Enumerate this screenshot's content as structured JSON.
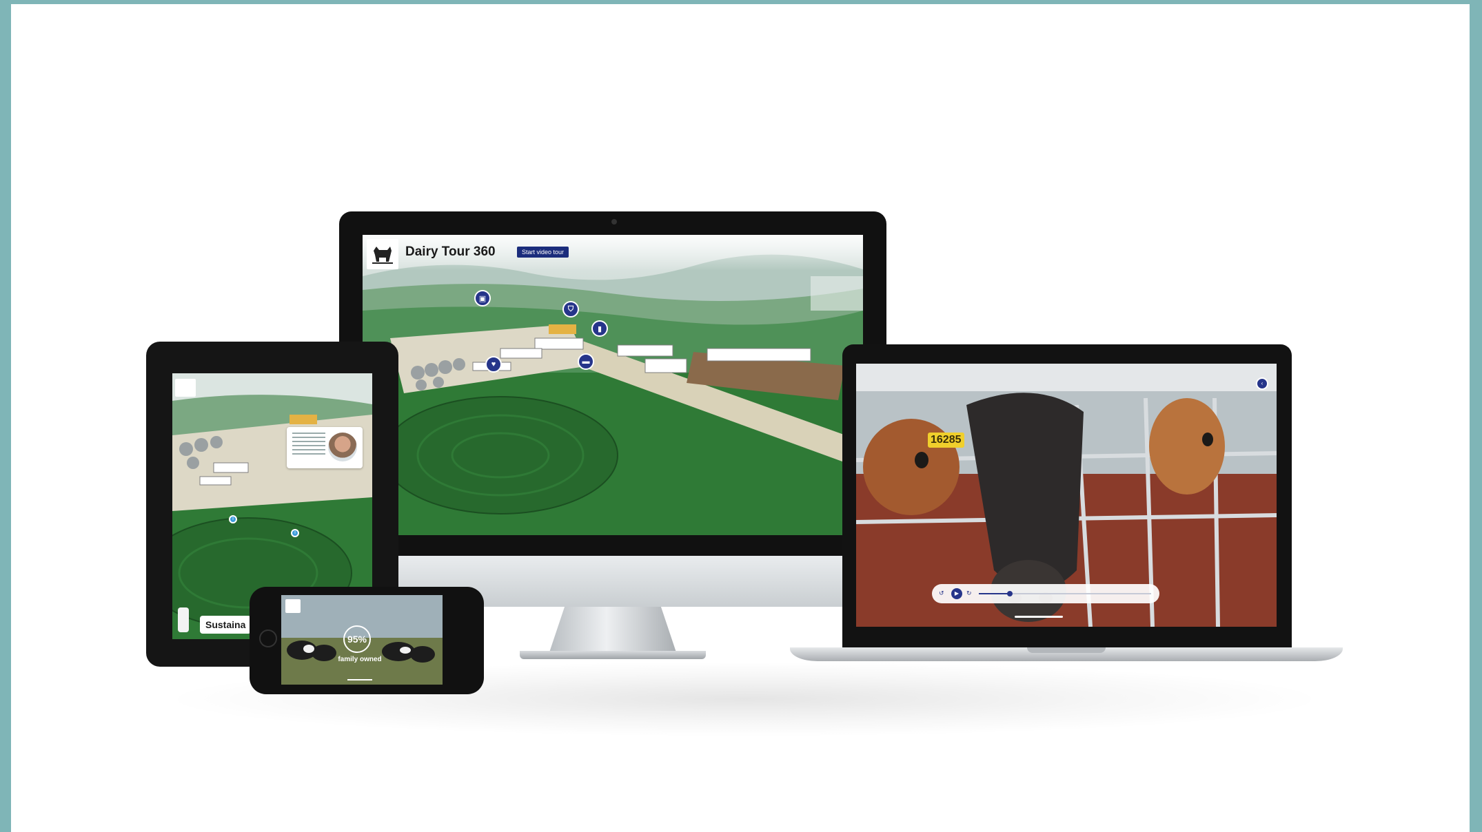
{
  "colors": {
    "page_border": "#7fb5b7",
    "brand_navy": "#26358a",
    "tablet_dot": "#3e9ddb",
    "field_green": "#2f7a36"
  },
  "imac": {
    "app_title": "Dairy Tour 360",
    "cta_label": "Start video tour",
    "logo_icon": "cow-logo-icon",
    "hotspots": [
      {
        "icon": "bag-icon",
        "glyph": "▣"
      },
      {
        "icon": "milk-machine-icon",
        "glyph": "⛉"
      },
      {
        "icon": "bottle-icon",
        "glyph": "▮"
      },
      {
        "icon": "heart-icon",
        "glyph": "♥"
      },
      {
        "icon": "truck-icon",
        "glyph": "▬"
      }
    ],
    "social_icons": [
      "send-icon",
      "link-icon",
      "twitter-icon",
      "facebook-icon",
      "pinterest-icon"
    ]
  },
  "laptop": {
    "video": {
      "progress": 0.18,
      "play_icon": "play-icon"
    },
    "cow_tags": [
      "16285"
    ]
  },
  "tablet": {
    "section_label": "Sustaina",
    "hotspot_glyph": "i"
  },
  "phone": {
    "stat_value": "95%",
    "stat_caption": "family owned"
  }
}
